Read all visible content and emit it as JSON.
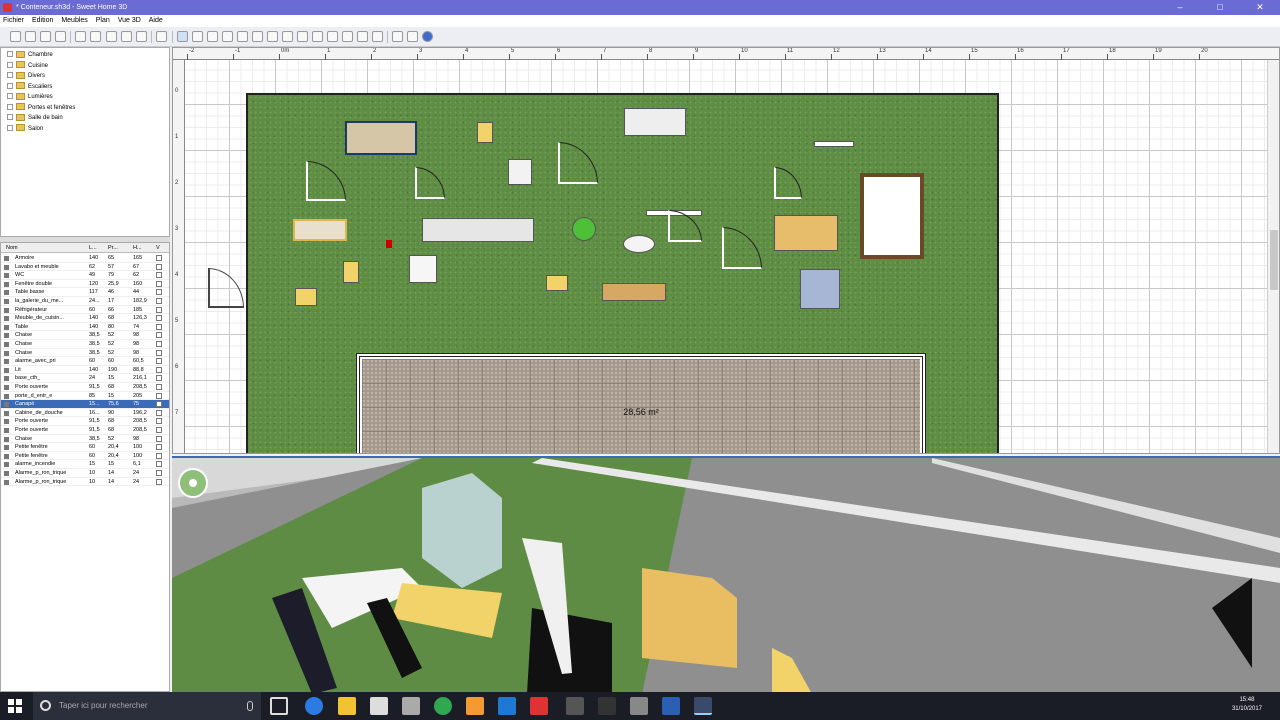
{
  "window": {
    "title": "* Conteneur.sh3d - Sweet Home 3D",
    "min": "–",
    "max": "□",
    "close": "✕"
  },
  "menu": [
    "Fichier",
    "Edition",
    "Meubles",
    "Plan",
    "Vue 3D",
    "Aide"
  ],
  "catalog": [
    "Chambre",
    "Cuisine",
    "Divers",
    "Escaliers",
    "Lumières",
    "Portes et fenêtres",
    "Salle de bain",
    "Salon"
  ],
  "furniture": {
    "headers": [
      "Nom",
      "L...",
      "Pr...",
      "H...",
      "V"
    ],
    "rows": [
      {
        "name": "Armoire",
        "w": "140",
        "d": "65",
        "h": "165"
      },
      {
        "name": "Lavabo et meuble",
        "w": "62",
        "d": "57",
        "h": "67"
      },
      {
        "name": "WC",
        "w": "49",
        "d": "79",
        "h": "62"
      },
      {
        "name": "Fenêtre double",
        "w": "120",
        "d": "25,9",
        "h": "160"
      },
      {
        "name": "Table basse",
        "w": "117",
        "d": "46",
        "h": "44"
      },
      {
        "name": "la_galerie_du_me...",
        "w": "24...",
        "d": "17",
        "h": "182,9"
      },
      {
        "name": "Réfrigérateur",
        "w": "60",
        "d": "66",
        "h": "185"
      },
      {
        "name": "Meuble_de_cuisin...",
        "w": "140",
        "d": "68",
        "h": "126,3"
      },
      {
        "name": "Table",
        "w": "140",
        "d": "80",
        "h": "74"
      },
      {
        "name": "Chaise",
        "w": "38,5",
        "d": "52",
        "h": "98"
      },
      {
        "name": "Chaise",
        "w": "38,5",
        "d": "52",
        "h": "98"
      },
      {
        "name": "Chaise",
        "w": "38,5",
        "d": "52",
        "h": "98"
      },
      {
        "name": "alarme_avec_pri",
        "w": "60",
        "d": "60",
        "h": "60,5"
      },
      {
        "name": "Lit",
        "w": "140",
        "d": "190",
        "h": "88,8"
      },
      {
        "name": "base_cth_",
        "w": "24",
        "d": "15",
        "h": "216,1"
      },
      {
        "name": "Porte ouverte",
        "w": "91,5",
        "d": "68",
        "h": "208,5"
      },
      {
        "name": "porte_d_entr_e",
        "w": "85",
        "d": "15",
        "h": "205"
      },
      {
        "name": "Canapé",
        "w": "15...",
        "d": "75,6",
        "h": "75"
      },
      {
        "name": "Cabine_de_douche",
        "w": "16...",
        "d": "90",
        "h": "196,2"
      },
      {
        "name": "Porte ouverte",
        "w": "91,5",
        "d": "68",
        "h": "208,5"
      },
      {
        "name": "Porte ouverte",
        "w": "91,5",
        "d": "68",
        "h": "208,5"
      },
      {
        "name": "Chaise",
        "w": "38,5",
        "d": "52",
        "h": "98"
      },
      {
        "name": "Petite fenêtre",
        "w": "60",
        "d": "20,4",
        "h": "100"
      },
      {
        "name": "Petite fenêtre",
        "w": "60",
        "d": "20,4",
        "h": "100"
      },
      {
        "name": "alarme_incendie",
        "w": "15",
        "d": "15",
        "h": "6,1"
      },
      {
        "name": "Alarme_p_ron_trique",
        "w": "10",
        "d": "14",
        "h": "24"
      },
      {
        "name": "Alarme_p_ron_trique",
        "w": "10",
        "d": "14",
        "h": "24"
      }
    ],
    "selected_index": 17
  },
  "plan": {
    "ruler_labels": [
      "-2",
      "-1",
      "0m",
      "1",
      "2",
      "3",
      "4",
      "5",
      "6",
      "7",
      "8",
      "9",
      "10",
      "11",
      "12",
      "13",
      "14",
      "15",
      "16",
      "17",
      "18",
      "19",
      "20"
    ],
    "vruler_labels": [
      "0",
      "1",
      "2",
      "3",
      "4",
      "5",
      "6",
      "7"
    ],
    "room_area": "28,56 m²"
  },
  "taskbar": {
    "search_placeholder": "Taper ici pour rechercher",
    "time": "15:48",
    "date": "31/10/2017"
  },
  "colors": {
    "title_bg": "#6b6bd6",
    "grass": "#5f8d45",
    "selection": "#3a6ab8"
  }
}
